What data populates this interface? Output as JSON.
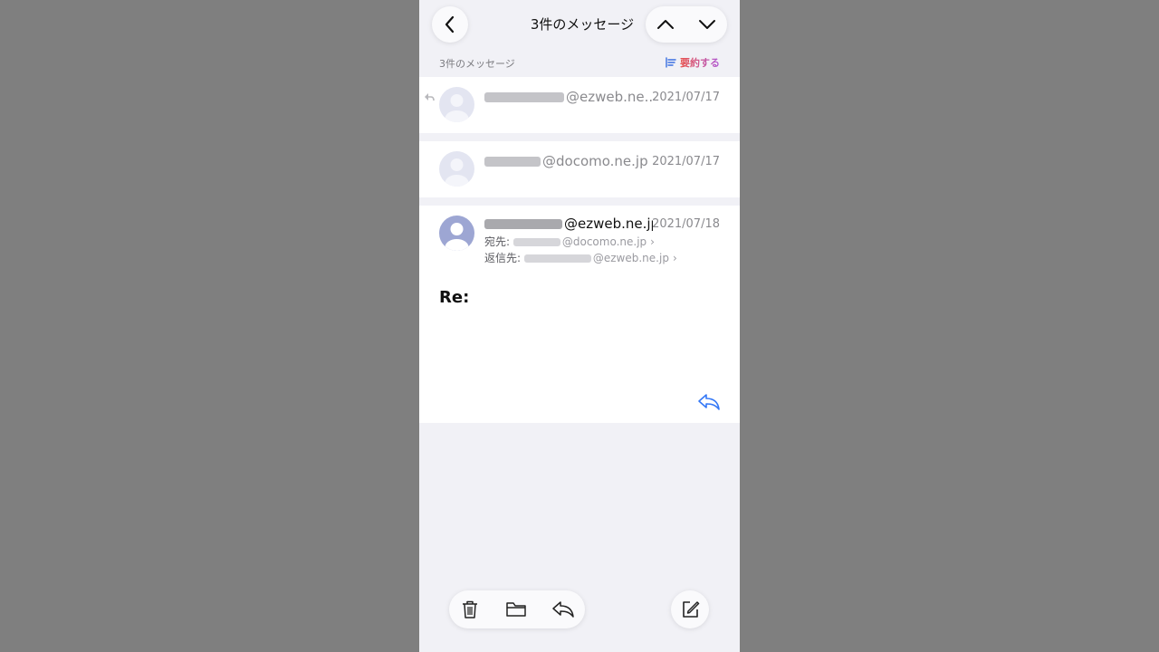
{
  "header": {
    "title": "3件のメッセージ"
  },
  "list_header": {
    "count_label": "3件のメッセージ",
    "summarize_label": "要約する"
  },
  "messages": [
    {
      "sender_domain": "@ezweb.ne...",
      "date": "2021/07/17",
      "replied": true
    },
    {
      "sender_domain": "@docomo.ne.jp",
      "date": "2021/07/17",
      "replied": false
    },
    {
      "sender_domain": "@ezweb.ne.jp",
      "date": "2021/07/18",
      "to_label": "宛先:",
      "to_domain": "@docomo.ne.jp",
      "reply_to_label": "返信先:",
      "reply_to_domain": "@ezweb.ne.jp",
      "subject": "Re:"
    }
  ],
  "toolbar": {
    "icons": [
      "trash-icon",
      "folder-icon",
      "reply-icon",
      "compose-icon"
    ]
  },
  "colors": {
    "accent": "#3478f6",
    "background": "#f1f1f6",
    "outer": "#7f7f7f"
  }
}
